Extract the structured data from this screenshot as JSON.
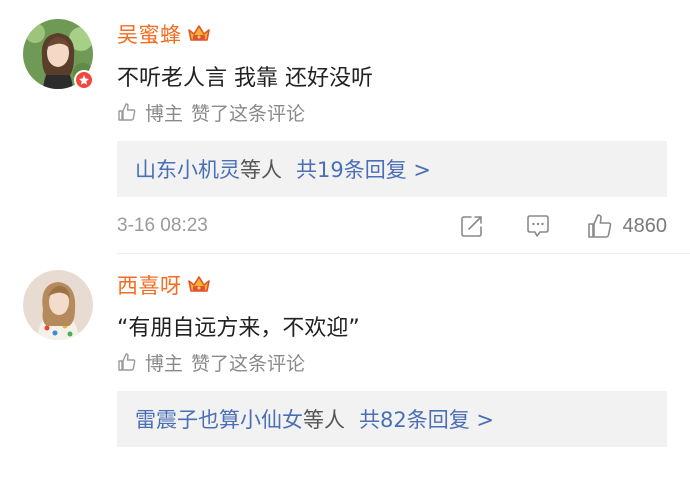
{
  "comments": [
    {
      "username": "吴蜜蜂",
      "text": "不听老人言 我靠 还好没听",
      "like_label_a": "博主",
      "like_label_b": "赞了这条评论",
      "reply_names": "山东小机灵",
      "reply_suffix": "等人",
      "reply_count": "共19条回复 >",
      "timestamp": "3-16 08:23",
      "like_count": "4860"
    },
    {
      "username": "西喜呀",
      "text": "“有朋自远方来，不欢迎”",
      "like_label_a": "博主",
      "like_label_b": "赞了这条评论",
      "reply_names": "雷震子也算小仙女",
      "reply_suffix": "等人",
      "reply_count": "共82条回复 >"
    }
  ],
  "colors": {
    "username": "#f36d20",
    "link": "#4b6fb5",
    "muted": "#8a8a8a",
    "reply_bg": "#f2f2f2",
    "vip_badge": "#f2473d"
  },
  "icons": [
    "thumb-up-icon",
    "crown-badge-icon",
    "share-icon",
    "comment-icon",
    "like-icon",
    "vip-badge-icon"
  ]
}
